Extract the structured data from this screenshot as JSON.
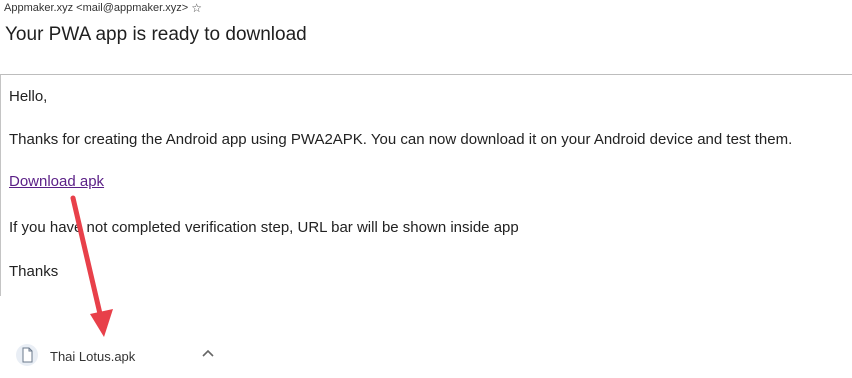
{
  "email": {
    "sender": "Appmaker.xyz <mail@appmaker.xyz>",
    "subject": "Your PWA app is ready to download",
    "greeting": "Hello,",
    "paragraph1": "Thanks for creating the Android app using PWA2APK. You can now download it on your Android device and test them.",
    "link_text": "Download apk",
    "paragraph2": "If you have not completed verification step, URL bar will be shown inside app",
    "closing": "Thanks"
  },
  "download_bar": {
    "file_name": "Thai Lotus.apk",
    "file_icon": "document-icon",
    "chevron_icon": "chevron-up-icon"
  },
  "annotation": {
    "arrow_color": "#e8404a"
  },
  "colors": {
    "link": "#5a1f86",
    "text": "#222222"
  }
}
